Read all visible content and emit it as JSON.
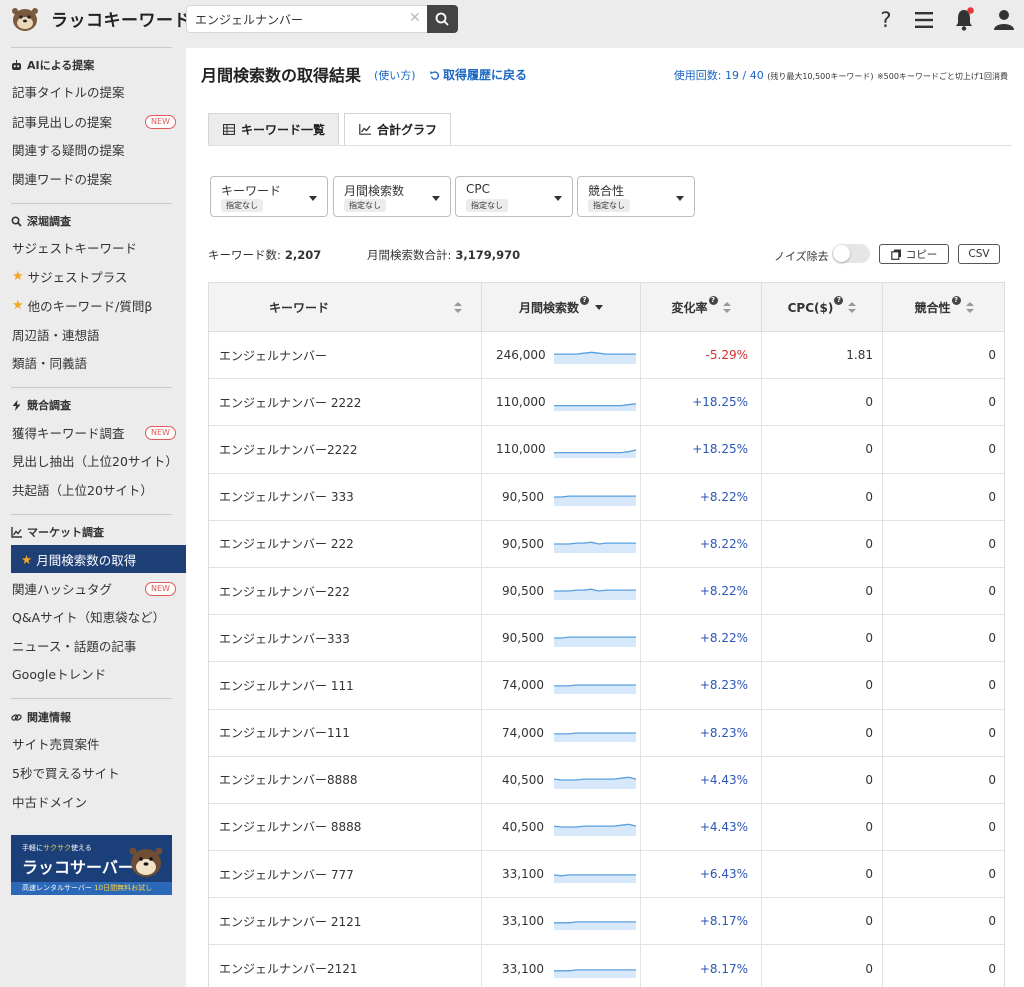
{
  "app": {
    "logo_text": "ラッコキーワード",
    "search": {
      "value": "エンジェルナンバー",
      "clear_icon": "close-icon",
      "button_icon": "search-icon"
    },
    "top_icons": [
      "help-icon",
      "menu-icon",
      "bell-icon",
      "user-icon"
    ]
  },
  "sidebar": {
    "sections": [
      {
        "title": "AIによる提案",
        "icon": "robot-icon",
        "items": [
          {
            "label": "記事タイトルの提案"
          },
          {
            "label": "記事見出しの提案",
            "badge": "NEW"
          },
          {
            "label": "関連する疑問の提案"
          },
          {
            "label": "関連ワードの提案"
          }
        ]
      },
      {
        "title": "深堀調査",
        "icon": "search-icon",
        "items": [
          {
            "label": "サジェストキーワード"
          },
          {
            "label": "サジェストプラス",
            "star": true
          },
          {
            "label": "他のキーワード/質問β",
            "star": true
          },
          {
            "label": "周辺語・連想語"
          },
          {
            "label": "類語・同義語"
          }
        ]
      },
      {
        "title": "競合調査",
        "icon": "bolt-icon",
        "items": [
          {
            "label": "獲得キーワード調査",
            "badge": "NEW"
          },
          {
            "label": "見出し抽出（上位20サイト）"
          },
          {
            "label": "共起語（上位20サイト）"
          }
        ]
      },
      {
        "title": "マーケット調査",
        "icon": "chart-icon",
        "items": [
          {
            "label": "月間検索数の取得",
            "star": true,
            "active": true
          },
          {
            "label": "関連ハッシュタグ",
            "badge": "NEW"
          },
          {
            "label": "Q&Aサイト（知恵袋など）"
          },
          {
            "label": "ニュース・話題の記事"
          },
          {
            "label": "Googleトレンド"
          }
        ]
      },
      {
        "title": "関連情報",
        "icon": "link-icon",
        "items": [
          {
            "label": "サイト売買案件"
          },
          {
            "label": "5秒で買えるサイト"
          },
          {
            "label": "中古ドメイン"
          }
        ]
      }
    ],
    "banner": {
      "top_prefix": "手軽に",
      "top_highlight": "サクサク",
      "top_suffix": "使える",
      "title": "ラッコサーバー",
      "strip_prefix": "高速レンタルサーバー",
      "strip_highlight": "10日間無料お試し"
    }
  },
  "main": {
    "title": "月間検索数の取得結果",
    "help_link": "(使い方)",
    "back_link": "取得履歴に戻る",
    "usage_label": "使用回数: 19 / 40",
    "usage_small": "(残り最大10,500キーワード)",
    "usage_note": "※500キーワードごと切上げ1回消費",
    "tabs": [
      {
        "label": "キーワード一覧",
        "active": true
      },
      {
        "label": "合計グラフ",
        "active": false
      }
    ],
    "filters": [
      {
        "label": "キーワード",
        "value": "指定なし"
      },
      {
        "label": "月間検索数",
        "value": "指定なし"
      },
      {
        "label": "CPC",
        "value": "指定なし"
      },
      {
        "label": "競合性",
        "value": "指定なし"
      }
    ],
    "stats": {
      "keyword_count_label": "キーワード数:",
      "keyword_count": "2,207",
      "volume_total_label": "月間検索数合計:",
      "volume_total": "3,179,970"
    },
    "noise_label": "ノイズ除去",
    "copy_label": "コピー",
    "csv_label": "CSV",
    "table": {
      "headers": {
        "keyword": "キーワード",
        "volume": "月間検索数",
        "change": "変化率",
        "cpc": "CPC($)",
        "competition": "競合性"
      },
      "rows": [
        {
          "keyword": "エンジェルナンバー",
          "volume": "246,000",
          "change": "-5.29%",
          "cpc": "1.81",
          "competition": "0",
          "trend": [
            0.55,
            0.55,
            0.55,
            0.55,
            0.6,
            0.65,
            0.6,
            0.55,
            0.55,
            0.55,
            0.55,
            0.55
          ]
        },
        {
          "keyword": "エンジェルナンバー 2222",
          "volume": "110,000",
          "change": "+18.25%",
          "cpc": "0",
          "competition": "0",
          "trend": [
            0.3,
            0.3,
            0.3,
            0.3,
            0.3,
            0.3,
            0.3,
            0.3,
            0.3,
            0.3,
            0.35,
            0.4
          ]
        },
        {
          "keyword": "エンジェルナンバー2222",
          "volume": "110,000",
          "change": "+18.25%",
          "cpc": "0",
          "competition": "0",
          "trend": [
            0.3,
            0.3,
            0.3,
            0.3,
            0.3,
            0.3,
            0.3,
            0.3,
            0.3,
            0.3,
            0.35,
            0.45
          ]
        },
        {
          "keyword": "エンジェルナンバー 333",
          "volume": "90,500",
          "change": "+8.22%",
          "cpc": "0",
          "competition": "0",
          "trend": [
            0.5,
            0.5,
            0.55,
            0.55,
            0.55,
            0.55,
            0.55,
            0.55,
            0.55,
            0.55,
            0.55,
            0.55
          ]
        },
        {
          "keyword": "エンジェルナンバー 222",
          "volume": "90,500",
          "change": "+8.22%",
          "cpc": "0",
          "competition": "0",
          "trend": [
            0.5,
            0.5,
            0.5,
            0.55,
            0.55,
            0.6,
            0.5,
            0.55,
            0.55,
            0.55,
            0.55,
            0.55
          ]
        },
        {
          "keyword": "エンジェルナンバー222",
          "volume": "90,500",
          "change": "+8.22%",
          "cpc": "0",
          "competition": "0",
          "trend": [
            0.5,
            0.5,
            0.5,
            0.55,
            0.55,
            0.6,
            0.5,
            0.55,
            0.55,
            0.55,
            0.55,
            0.55
          ]
        },
        {
          "keyword": "エンジェルナンバー333",
          "volume": "90,500",
          "change": "+8.22%",
          "cpc": "0",
          "competition": "0",
          "trend": [
            0.5,
            0.5,
            0.55,
            0.55,
            0.55,
            0.55,
            0.55,
            0.55,
            0.55,
            0.55,
            0.55,
            0.55
          ]
        },
        {
          "keyword": "エンジェルナンバー 111",
          "volume": "74,000",
          "change": "+8.23%",
          "cpc": "0",
          "competition": "0",
          "trend": [
            0.45,
            0.45,
            0.45,
            0.5,
            0.5,
            0.5,
            0.5,
            0.5,
            0.5,
            0.5,
            0.5,
            0.5
          ]
        },
        {
          "keyword": "エンジェルナンバー111",
          "volume": "74,000",
          "change": "+8.23%",
          "cpc": "0",
          "competition": "0",
          "trend": [
            0.45,
            0.45,
            0.45,
            0.5,
            0.5,
            0.5,
            0.5,
            0.5,
            0.5,
            0.5,
            0.5,
            0.5
          ]
        },
        {
          "keyword": "エンジェルナンバー8888",
          "volume": "40,500",
          "change": "+4.43%",
          "cpc": "0",
          "competition": "0",
          "trend": [
            0.55,
            0.5,
            0.5,
            0.5,
            0.55,
            0.55,
            0.55,
            0.55,
            0.55,
            0.6,
            0.65,
            0.55
          ]
        },
        {
          "keyword": "エンジェルナンバー 8888",
          "volume": "40,500",
          "change": "+4.43%",
          "cpc": "0",
          "competition": "0",
          "trend": [
            0.55,
            0.5,
            0.5,
            0.5,
            0.55,
            0.55,
            0.55,
            0.55,
            0.55,
            0.6,
            0.65,
            0.55
          ]
        },
        {
          "keyword": "エンジェルナンバー 777",
          "volume": "33,100",
          "change": "+6.43%",
          "cpc": "0",
          "competition": "0",
          "trend": [
            0.45,
            0.4,
            0.45,
            0.45,
            0.45,
            0.45,
            0.45,
            0.45,
            0.45,
            0.45,
            0.45,
            0.45
          ]
        },
        {
          "keyword": "エンジェルナンバー 2121",
          "volume": "33,100",
          "change": "+8.17%",
          "cpc": "0",
          "competition": "0",
          "trend": [
            0.4,
            0.4,
            0.4,
            0.45,
            0.45,
            0.45,
            0.45,
            0.45,
            0.45,
            0.45,
            0.45,
            0.45
          ]
        },
        {
          "keyword": "エンジェルナンバー2121",
          "volume": "33,100",
          "change": "+8.17%",
          "cpc": "0",
          "competition": "0",
          "trend": [
            0.4,
            0.4,
            0.4,
            0.45,
            0.45,
            0.45,
            0.45,
            0.45,
            0.45,
            0.45,
            0.45,
            0.45
          ]
        }
      ]
    }
  },
  "colors": {
    "accent": "#1f3f77",
    "link": "#1a66c2",
    "positive": "#2c56b8",
    "negative": "#d32f2f",
    "spark_line": "#5aa0e0",
    "spark_fill": "#d6e8fa",
    "new_badge": "#e05a5a",
    "notify_dot": "#e53935"
  }
}
